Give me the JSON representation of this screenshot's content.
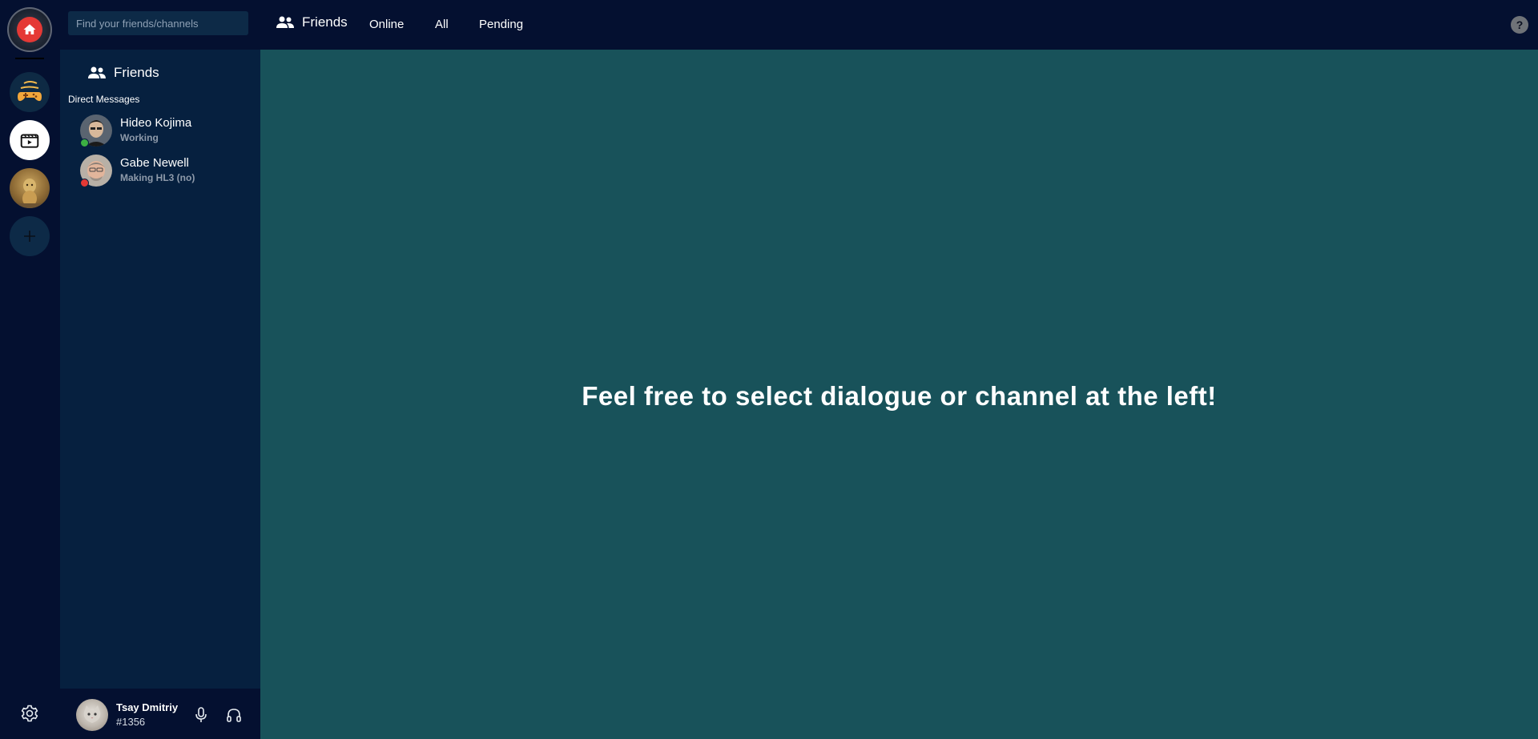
{
  "search": {
    "placeholder": "Find your friends/channels"
  },
  "topbar": {
    "friends_label": "Friends",
    "tabs": [
      {
        "label": "Online"
      },
      {
        "label": "All"
      },
      {
        "label": "Pending"
      }
    ],
    "help_label": "?"
  },
  "servers": [
    {
      "name": "home",
      "icon": "home-icon",
      "accent": "#e53935"
    },
    {
      "name": "games",
      "icon": "gamepad-icon"
    },
    {
      "name": "video",
      "icon": "video-play-icon"
    },
    {
      "name": "dog",
      "icon": "dog-avatar"
    },
    {
      "name": "add",
      "icon": "plus-icon"
    }
  ],
  "sidebar": {
    "friends_label": "Friends",
    "dm_title": "Direct Messages",
    "dms": [
      {
        "name": "Hideo Kojima",
        "status": "Working",
        "presence_color": "#3cb043"
      },
      {
        "name": "Gabe Newell",
        "status": "Making HL3 (no)",
        "presence_color": "#e53935"
      }
    ]
  },
  "user": {
    "name": "Tsay Dmitriy",
    "tag": "#1356"
  },
  "main": {
    "message": "Feel free to select dialogue or channel at the left!"
  },
  "colors": {
    "background": "#041030",
    "sidebar": "#06203f",
    "main": "#18525a",
    "search_bg": "#0d2a47"
  }
}
